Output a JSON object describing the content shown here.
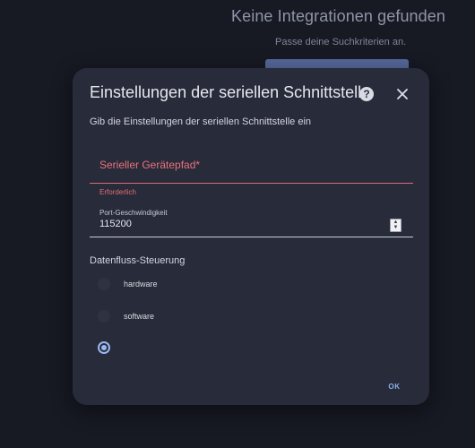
{
  "background": {
    "title": "Keine Integrationen gefunden",
    "subtitle": "Passe deine Suchkriterien an."
  },
  "dialog": {
    "title": "Einstellungen der seriellen Schnittstelle",
    "help_icon": "question-mark-icon",
    "close_icon": "close-icon",
    "description": "Gib die Einstellungen der seriellen Schnittstelle ein",
    "path_field": {
      "label": "Serieller Gerätepfad*",
      "value": "",
      "error": "Erforderlich"
    },
    "speed_field": {
      "label": "Port-Geschwindigkeit",
      "value": "115200"
    },
    "flow_control": {
      "title": "Datenfluss-Steuerung",
      "options": [
        {
          "label": "hardware",
          "checked": false
        },
        {
          "label": "software",
          "checked": false
        },
        {
          "label": "",
          "checked": true
        }
      ]
    },
    "ok_label": "OK"
  },
  "colors": {
    "background": "#171923",
    "dialog": "#282b3a",
    "error": "#e9737b",
    "accent": "#9ab7ef"
  }
}
